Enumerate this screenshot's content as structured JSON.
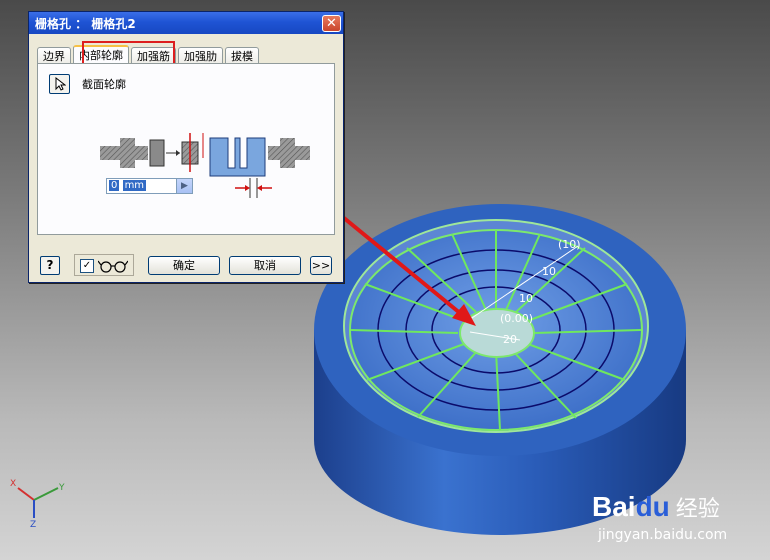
{
  "dialog": {
    "title": "栅格孔 ： 栅格孔2",
    "tabs": [
      {
        "label": "边界"
      },
      {
        "label": "内部轮廓"
      },
      {
        "label": "加强筋"
      },
      {
        "label": "加强肋"
      },
      {
        "label": "拔模"
      }
    ],
    "active_tab": "内部轮廓",
    "section_label": "截面轮廓",
    "value_input": {
      "value": "0",
      "unit": "mm"
    },
    "help_label": "?",
    "preview_checked": true,
    "buttons": {
      "ok": "确定",
      "cancel": "取消",
      "more": ">>"
    }
  },
  "model": {
    "dimensions": [
      "(10)",
      "10",
      "10",
      "(0.00)",
      "20"
    ],
    "body_color": "#2e5fb7",
    "highlight_color": "#66e05a",
    "annotation_arrow_color": "#e01818"
  },
  "axes": {
    "x": "X",
    "y": "Y",
    "z": "Z"
  },
  "watermark": {
    "logo_a": "Bai",
    "logo_b": "du",
    "text": "经验",
    "url": "jingyan.baidu.com"
  }
}
